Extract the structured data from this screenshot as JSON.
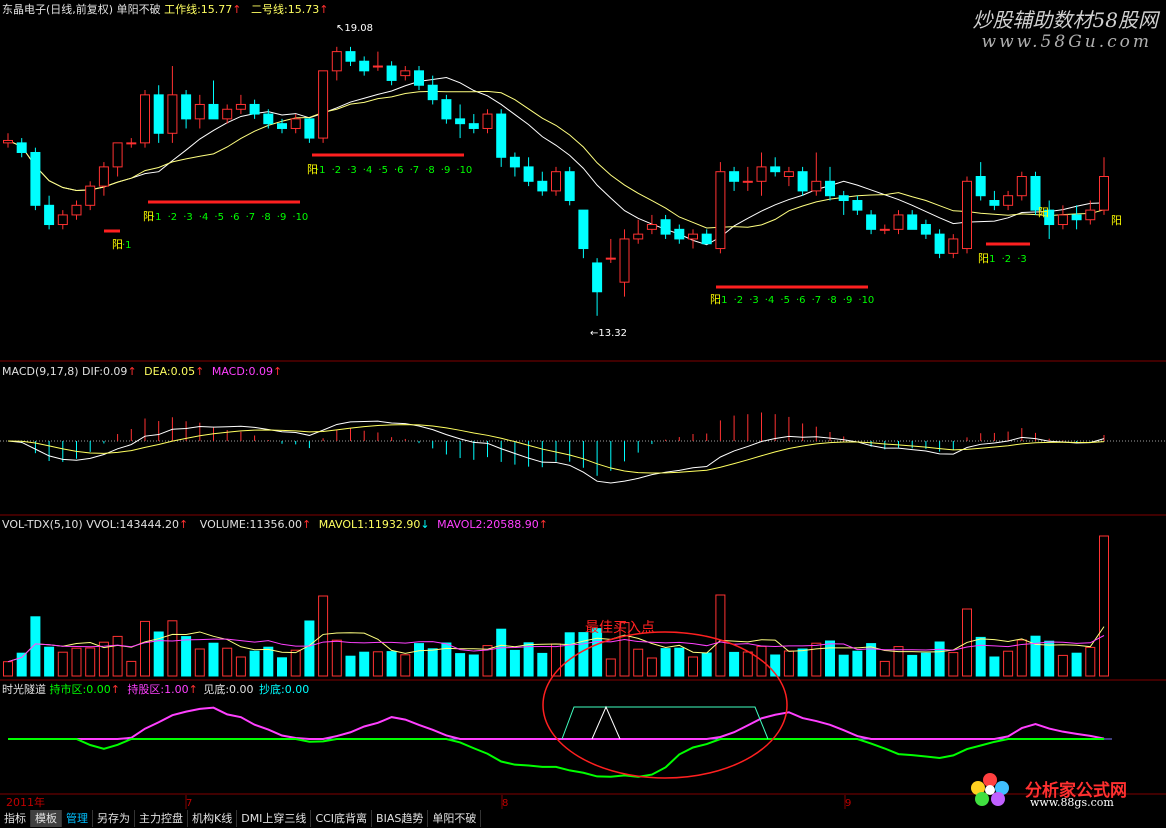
{
  "colors": {
    "up": "#ff3232",
    "down": "#00ffff",
    "ma1": "#ffffff",
    "ma2": "#ffff80",
    "dif": "#ffffff",
    "dea": "#ffff60",
    "vol_ma2": "#ff40ff",
    "hold": "#00ff00",
    "sell": "#ff40ff",
    "bottom": "#ffffff",
    "copy_bottom": "#00ffff",
    "signal_bar": "#ff2020",
    "count_text": "#00ff00",
    "yang_text": "#ffff00",
    "frame": "#800000"
  },
  "header": {
    "stock_name": "东晶电子(日线,前复权)",
    "indicator_name": "单阳不破",
    "line1_label": "工作线:15.77",
    "line2_label": "二号线:15.73",
    "arrow_up": "↑"
  },
  "macd": {
    "title": "MACD(9,17,8)",
    "dif": "DIF:0.09",
    "dea": "DEA:0.05",
    "macd": "MACD:0.09"
  },
  "vol": {
    "title": "VOL-TDX(5,10)",
    "vvol": "VVOL:143444.20",
    "volume": "VOLUME:11356.00",
    "mavol1": "MAVOL1:11932.90",
    "mavol2": "MAVOL2:20588.90"
  },
  "sgsd": {
    "title": "时光隧道",
    "hold": "持市区:0.00",
    "sell": "持股区:1.00",
    "bottom": "见底:0.00",
    "copy_bottom": "抄底:0.00"
  },
  "annotations": {
    "high_label": "19.08",
    "low_label": "13.32",
    "best_buy": "最佳买入点",
    "yang": "阳",
    "seq_10": [
      "1",
      "2",
      "3",
      "4",
      "5",
      "6",
      "7",
      "8",
      "9",
      "10"
    ],
    "seq_3": [
      "1",
      "2",
      "3"
    ],
    "seq_1": [
      "1"
    ]
  },
  "timeaxis": {
    "year": "2011年",
    "m1": "7",
    "m2": "8",
    "m3": "9"
  },
  "watermark": {
    "top_cn": "炒股辅助数材58股网",
    "top_url": "www.58Gu.com",
    "bottom_cn": "分析家公式网",
    "bottom_url": "www.88gs.com"
  },
  "tabs": [
    "指标",
    "模板",
    "管理",
    "另存为",
    "主力控盘",
    "机构K线",
    "DMI上穿三线",
    "CCI底背离",
    "BIAS趋势",
    "单阳不破"
  ],
  "chart_data": {
    "type": "candlestick",
    "high_mark": 19.08,
    "low_mark": 13.32,
    "ohlc": [
      [
        17.0,
        17.2,
        16.9,
        17.05
      ],
      [
        17.0,
        17.1,
        16.7,
        16.8
      ],
      [
        16.8,
        16.9,
        15.6,
        15.7
      ],
      [
        15.7,
        15.9,
        15.2,
        15.3
      ],
      [
        15.3,
        15.6,
        15.2,
        15.5
      ],
      [
        15.5,
        15.8,
        15.4,
        15.7
      ],
      [
        15.7,
        16.2,
        15.6,
        16.1
      ],
      [
        16.1,
        16.6,
        15.9,
        16.5
      ],
      [
        16.5,
        17.0,
        16.3,
        17.0
      ],
      [
        17.0,
        17.1,
        16.9,
        17.0
      ],
      [
        17.0,
        18.1,
        16.9,
        18.0
      ],
      [
        18.0,
        18.2,
        17.0,
        17.2
      ],
      [
        17.2,
        18.6,
        17.0,
        18.0
      ],
      [
        18.0,
        18.1,
        17.3,
        17.5
      ],
      [
        17.5,
        18.0,
        17.3,
        17.8
      ],
      [
        17.8,
        18.3,
        17.5,
        17.5
      ],
      [
        17.5,
        17.8,
        17.4,
        17.7
      ],
      [
        17.7,
        18.0,
        17.6,
        17.8
      ],
      [
        17.8,
        17.9,
        17.5,
        17.6
      ],
      [
        17.6,
        17.7,
        17.3,
        17.4
      ],
      [
        17.4,
        17.5,
        17.2,
        17.3
      ],
      [
        17.3,
        17.6,
        17.2,
        17.5
      ],
      [
        17.5,
        17.5,
        17.0,
        17.1
      ],
      [
        17.1,
        18.5,
        17.0,
        18.5
      ],
      [
        18.5,
        19.0,
        18.3,
        18.9
      ],
      [
        18.9,
        19.0,
        18.6,
        18.7
      ],
      [
        18.7,
        18.8,
        18.4,
        18.5
      ],
      [
        18.6,
        18.9,
        18.5,
        18.6
      ],
      [
        18.6,
        18.7,
        18.2,
        18.3
      ],
      [
        18.4,
        18.6,
        18.3,
        18.5
      ],
      [
        18.5,
        18.6,
        18.1,
        18.2
      ],
      [
        18.2,
        18.4,
        17.8,
        17.9
      ],
      [
        17.9,
        18.0,
        17.4,
        17.5
      ],
      [
        17.5,
        17.8,
        17.1,
        17.4
      ],
      [
        17.4,
        17.6,
        17.2,
        17.3
      ],
      [
        17.3,
        17.7,
        17.2,
        17.6
      ],
      [
        17.6,
        17.7,
        16.5,
        16.7
      ],
      [
        16.7,
        16.8,
        16.3,
        16.5
      ],
      [
        16.5,
        16.7,
        16.1,
        16.2
      ],
      [
        16.2,
        16.4,
        15.9,
        16.0
      ],
      [
        16.0,
        16.5,
        15.9,
        16.4
      ],
      [
        16.4,
        16.5,
        15.7,
        15.8
      ],
      [
        15.6,
        15.6,
        14.6,
        14.8
      ],
      [
        14.5,
        14.6,
        13.4,
        13.9
      ],
      [
        14.6,
        15.0,
        14.5,
        14.6
      ],
      [
        14.1,
        15.2,
        13.8,
        15.0
      ],
      [
        15.0,
        15.4,
        14.9,
        15.1
      ],
      [
        15.2,
        15.5,
        15.1,
        15.3
      ],
      [
        15.4,
        15.5,
        15.0,
        15.1
      ],
      [
        15.2,
        15.3,
        14.9,
        15.0
      ],
      [
        15.0,
        15.2,
        14.8,
        15.1
      ],
      [
        15.1,
        15.2,
        14.9,
        14.9
      ],
      [
        14.8,
        16.6,
        14.7,
        16.4
      ],
      [
        16.4,
        16.5,
        16.0,
        16.2
      ],
      [
        16.2,
        16.5,
        16.0,
        16.2
      ],
      [
        16.2,
        16.8,
        15.9,
        16.5
      ],
      [
        16.5,
        16.7,
        16.3,
        16.4
      ],
      [
        16.3,
        16.5,
        16.1,
        16.4
      ],
      [
        16.4,
        16.5,
        15.9,
        16.0
      ],
      [
        16.0,
        16.8,
        15.9,
        16.2
      ],
      [
        16.2,
        16.5,
        15.8,
        15.9
      ],
      [
        15.9,
        16.0,
        15.5,
        15.8
      ],
      [
        15.8,
        15.9,
        15.5,
        15.6
      ],
      [
        15.5,
        15.6,
        15.1,
        15.2
      ],
      [
        15.2,
        15.3,
        15.1,
        15.2
      ],
      [
        15.2,
        15.6,
        15.1,
        15.5
      ],
      [
        15.5,
        15.6,
        15.2,
        15.2
      ],
      [
        15.3,
        15.4,
        15.0,
        15.1
      ],
      [
        15.1,
        15.2,
        14.6,
        14.7
      ],
      [
        14.7,
        15.1,
        14.6,
        15.0
      ],
      [
        14.8,
        16.3,
        14.7,
        16.2
      ],
      [
        16.3,
        16.6,
        15.8,
        15.9
      ],
      [
        15.8,
        16.0,
        15.6,
        15.7
      ],
      [
        15.7,
        16.0,
        15.6,
        15.9
      ],
      [
        15.9,
        16.4,
        15.8,
        16.3
      ],
      [
        16.3,
        16.4,
        15.5,
        15.6
      ],
      [
        15.6,
        15.8,
        15.0,
        15.3
      ],
      [
        15.3,
        15.7,
        15.2,
        15.5
      ],
      [
        15.5,
        15.7,
        15.2,
        15.4
      ],
      [
        15.4,
        15.8,
        15.3,
        15.6
      ],
      [
        15.6,
        16.7,
        15.5,
        16.3
      ]
    ],
    "volume_label_values": {
      "vvol": 143444.2,
      "volume": 11356.0,
      "mavol1": 11932.9,
      "mavol2": 20588.9
    },
    "macd_label_values": {
      "dif": 0.09,
      "dea": 0.05,
      "macd": 0.09
    }
  }
}
